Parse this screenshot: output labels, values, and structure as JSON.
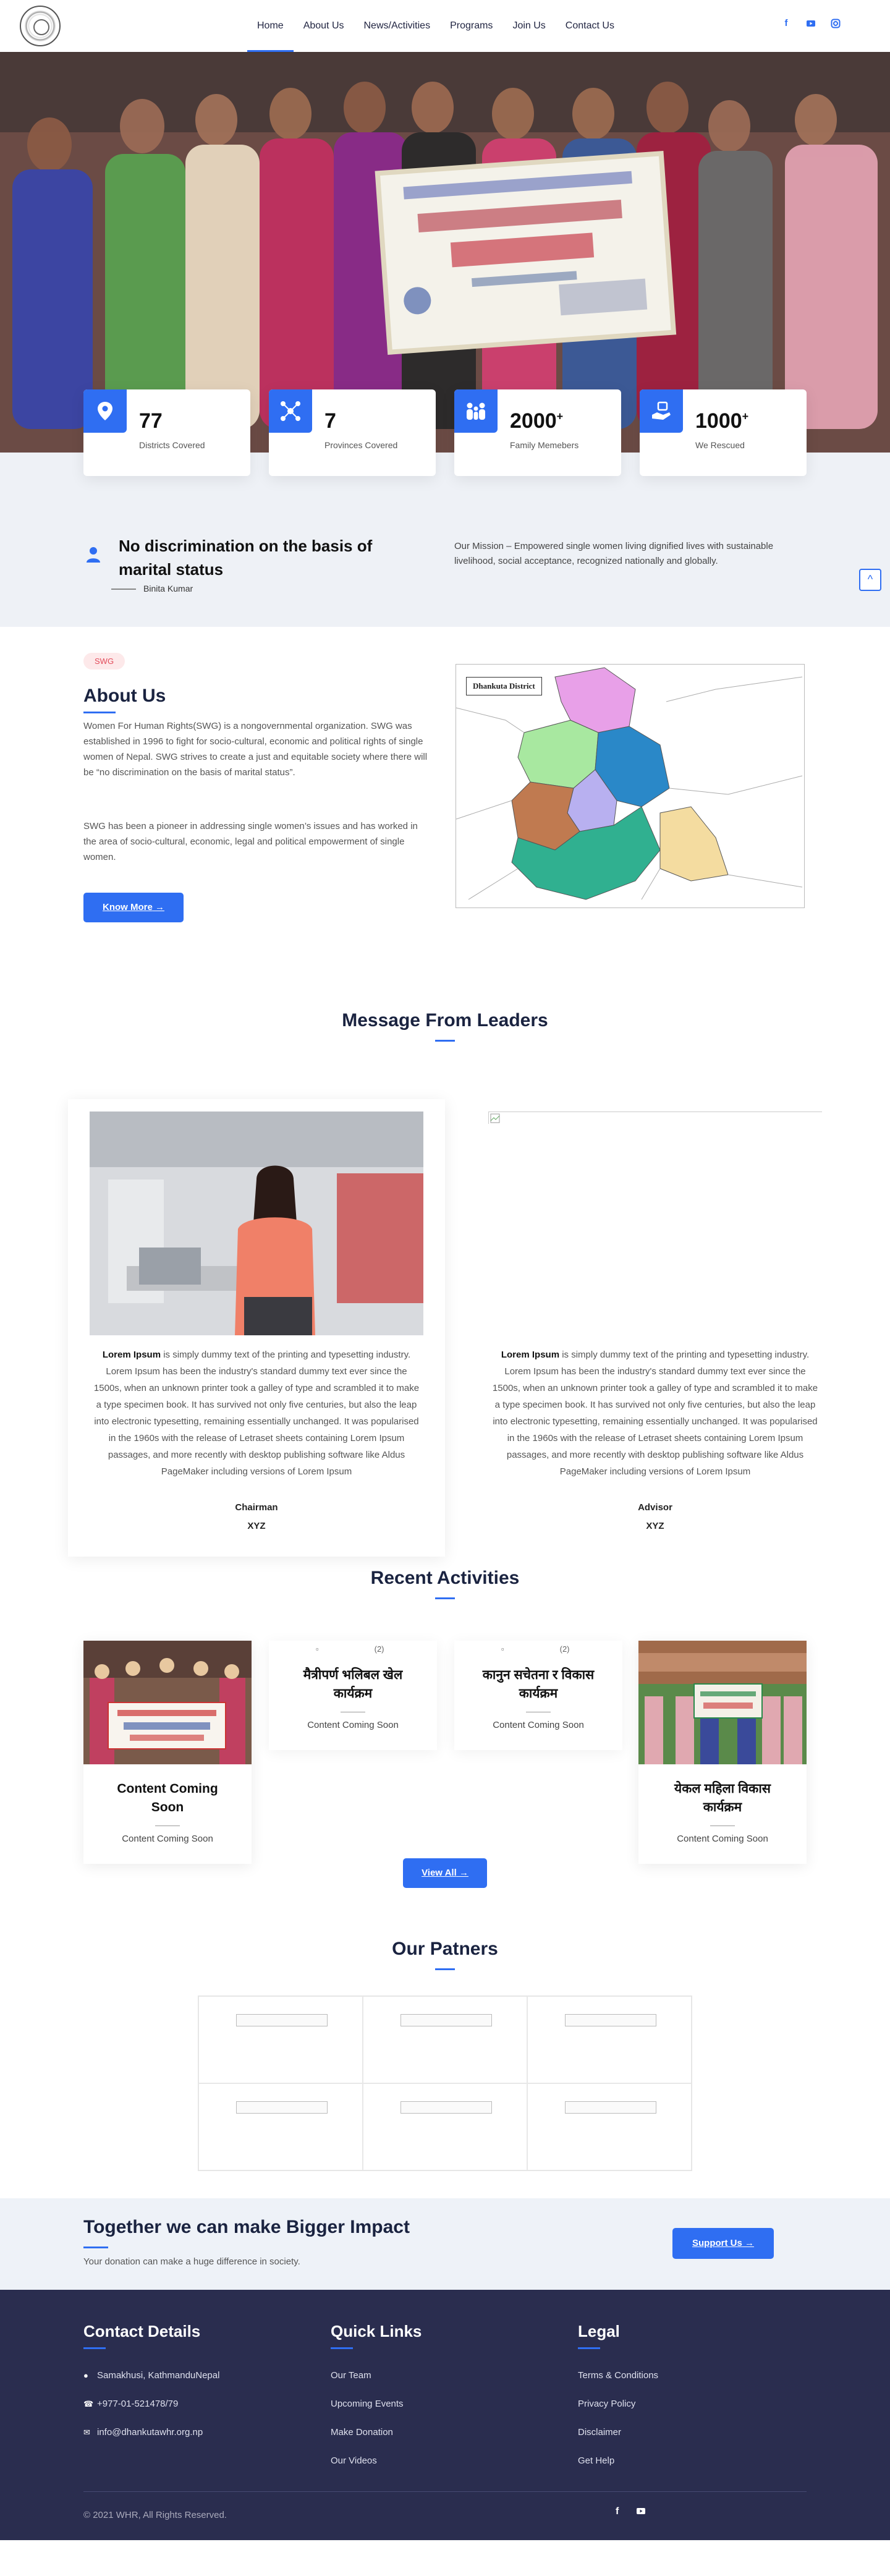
{
  "nav": {
    "items": [
      "Home",
      "About Us",
      "News/Activities",
      "Programs",
      "Join Us",
      "Contact Us"
    ],
    "social": [
      "facebook-icon",
      "youtube-icon",
      "instagram-icon"
    ]
  },
  "stats": [
    {
      "value": "77",
      "suffix": "",
      "label": "Districts Covered",
      "icon": "map-pin-icon"
    },
    {
      "value": "7",
      "suffix": "",
      "label": "Provinces Covered",
      "icon": "network-icon"
    },
    {
      "value": "2000",
      "suffix": "+",
      "label": "Family Memebers",
      "icon": "family-icon"
    },
    {
      "value": "1000",
      "suffix": "+",
      "label": "We Rescued",
      "icon": "helping-hand-icon"
    }
  ],
  "quote": {
    "heading": "No discrimination on the basis of marital status",
    "author": "Binita Kumar",
    "mission": "Our Mission – Empowered single women living dignified lives with sustainable livelihood, social acceptance, recognized nationally and globally."
  },
  "about": {
    "tag": "SWG",
    "title": "About Us",
    "para1": "Women For Human Rights(SWG) is a nongovernmental organization. SWG was established in 1996 to fight for socio-cultural, economic and political rights of single women of Nepal. SWG strives to create a just and equitable society where there will be “no discrimination on the basis of marital status”.",
    "para2": "SWG has been a pioneer in addressing single women’s issues and has worked in the area of socio-cultural, economic, legal and political empowerment of single women.",
    "button": "Know More",
    "map_title": "Dhankuta District"
  },
  "leaders": {
    "title": "Message From Leaders",
    "cards": [
      {
        "lead": "Lorem Ipsum",
        "text": " is simply dummy text of the printing and typesetting industry. Lorem Ipsum has been the industry's standard dummy text ever since the 1500s, when an unknown printer took a galley of type and scrambled it to make a type specimen book. It has survived not only five centuries, but also the leap into electronic typesetting, remaining essentially unchanged. It was popularised in the 1960s with the release of Letraset sheets containing Lorem Ipsum passages, and more recently with desktop publishing software like Aldus PageMaker including versions of Lorem Ipsum",
        "role": "Chairman",
        "name": "XYZ"
      },
      {
        "lead": "Lorem Ipsum",
        "text": " is simply dummy text of the printing and typesetting industry. Lorem Ipsum has been the industry's standard dummy text ever since the 1500s, when an unknown printer took a galley of type and scrambled it to make a type specimen book. It has survived not only five centuries, but also the leap into electronic typesetting, remaining essentially unchanged. It was popularised in the 1960s with the release of Letraset sheets containing Lorem Ipsum passages, and more recently with desktop publishing software like Aldus PageMaker including versions of Lorem Ipsum",
        "role": "Advisor",
        "name": "XYZ"
      }
    ]
  },
  "activities": {
    "title": "Recent Activities",
    "cards": [
      {
        "title": "Content Coming Soon",
        "sub": "Content Coming Soon",
        "broken": ""
      },
      {
        "title": "मैत्रीपर्ण भलिबल खेल कार्यक्रम",
        "sub": "Content Coming Soon",
        "broken": "(2)"
      },
      {
        "title": "कानुन सचेतना र विकास कार्यक्रम",
        "sub": "Content Coming Soon",
        "broken": "(2)"
      },
      {
        "title": "येकल महिला विकास कार्यक्रम",
        "sub": "Content Coming Soon",
        "broken": ""
      }
    ],
    "button": "View All"
  },
  "partners": {
    "title": "Our Patners"
  },
  "cta": {
    "title": "Together we can make Bigger Impact",
    "text": "Your donation can make a huge difference in society.",
    "button": "Support Us"
  },
  "footer": {
    "contact_title": "Contact Details",
    "contact": [
      {
        "icon": "location-pin-icon",
        "text": "Samakhusi, KathmanduNepal"
      },
      {
        "icon": "phone-icon",
        "text": "+977-01-521478/79"
      },
      {
        "icon": "email-icon",
        "text": "info@dhankutawhr.org.np"
      }
    ],
    "quick_title": "Quick Links",
    "quick": [
      "Our Team",
      "Upcoming Events",
      "Make Donation",
      "Our Videos"
    ],
    "legal_title": "Legal",
    "legal": [
      "Terms & Conditions",
      "Privacy Policy",
      "Disclaimer",
      "Get Help"
    ],
    "copyright": "© 2021 WHR, All Rights Reserved."
  },
  "colors": {
    "accent": "#2f6ef2",
    "footer_bg": "#2a2d4f",
    "band_bg": "#eef1f6"
  }
}
